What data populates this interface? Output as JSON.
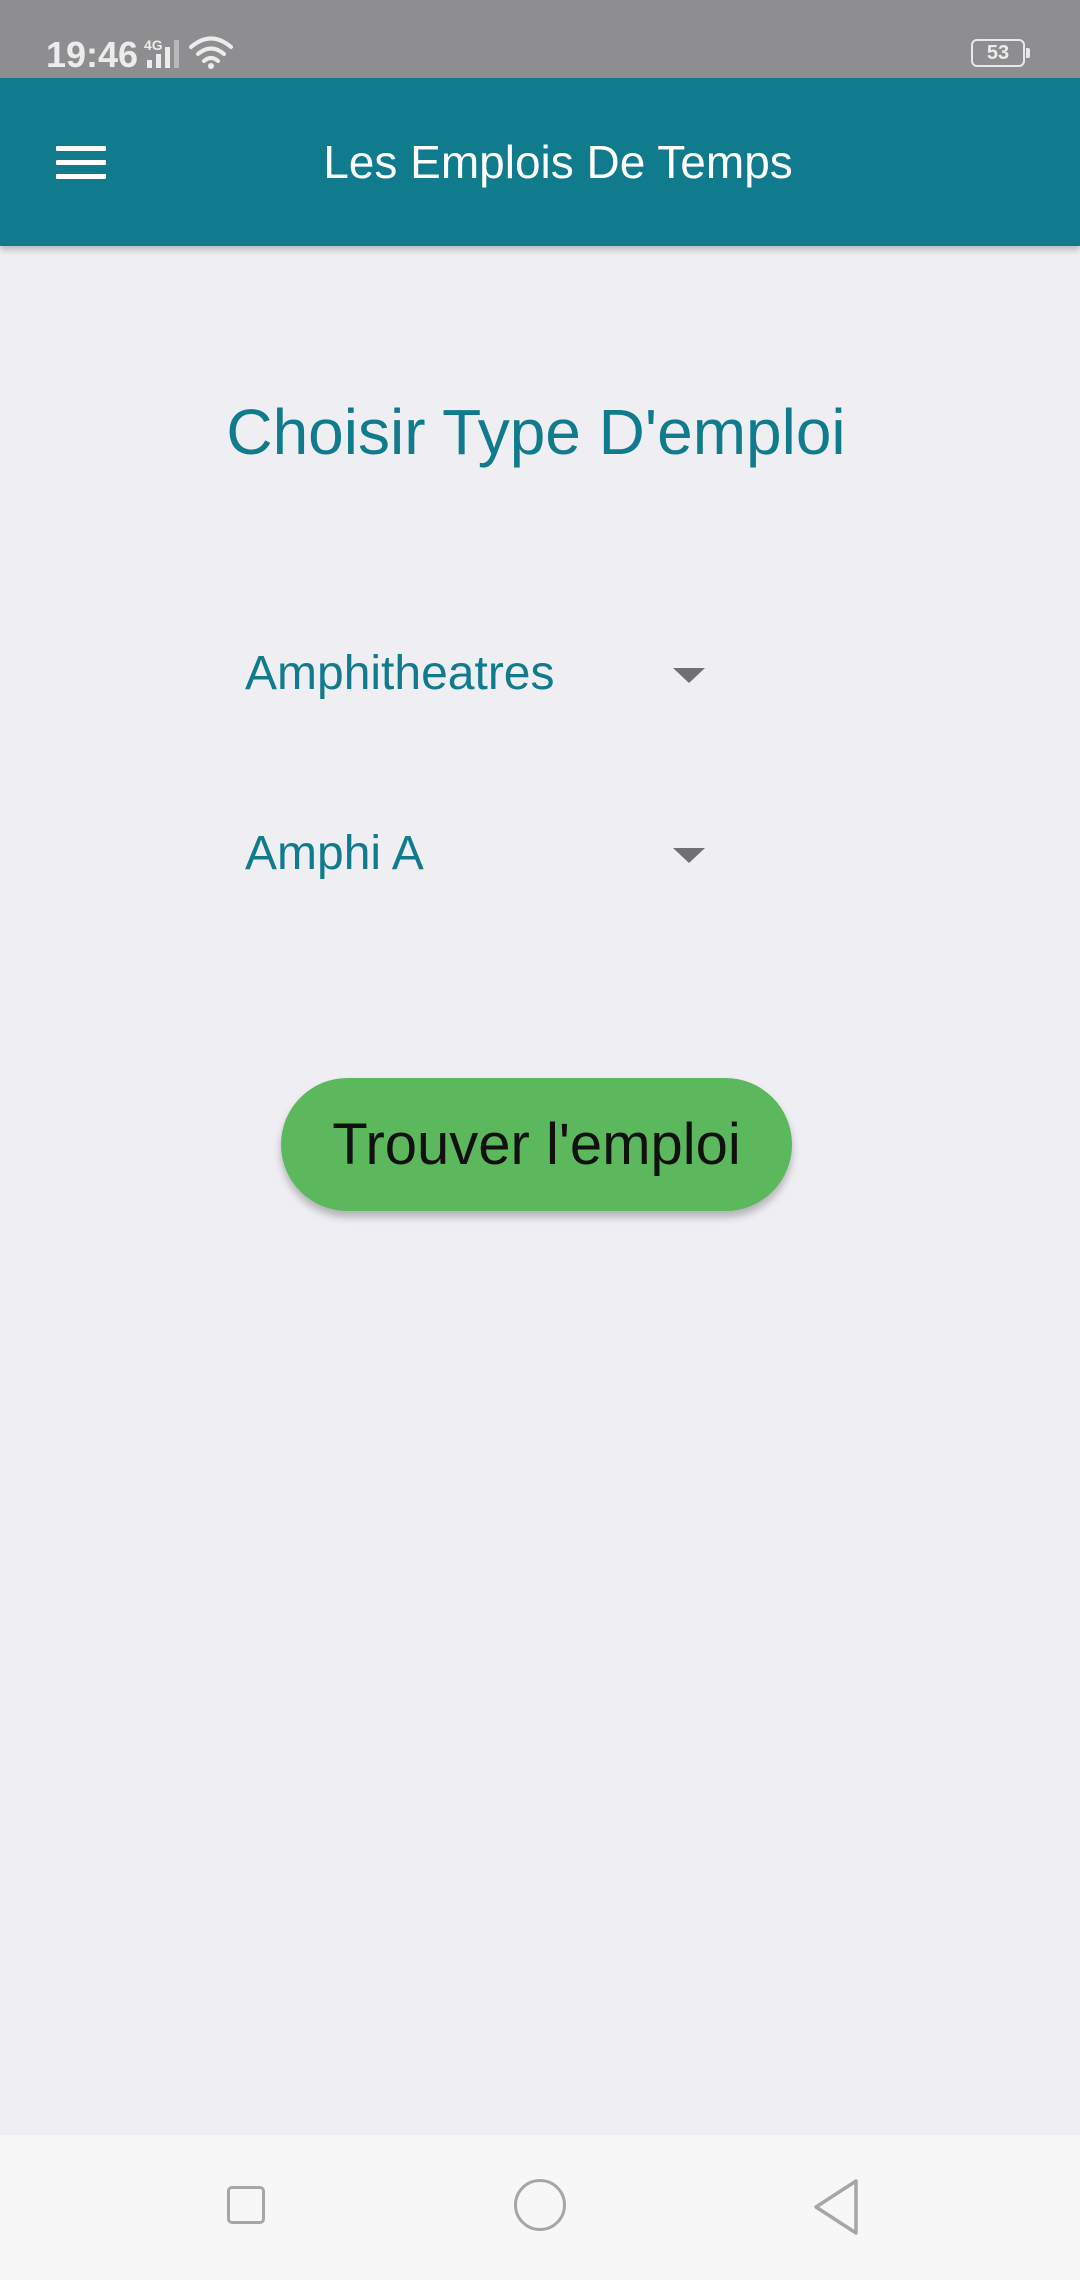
{
  "status_bar": {
    "time": "19:46",
    "network": "4G",
    "battery": "53",
    "icons": [
      "signal-icon",
      "wifi-icon",
      "battery-icon"
    ]
  },
  "app_bar": {
    "menu_icon": "hamburger-menu-icon",
    "title": "Les Emplois De Temps",
    "color": "#0f7b8c"
  },
  "main": {
    "heading": "Choisir Type D'emploi",
    "type_dropdown": {
      "selected": "Amphitheatres"
    },
    "room_dropdown": {
      "selected": "Amphi A"
    },
    "find_button": {
      "label": "Trouver l'emploi",
      "color": "#5cb85c"
    }
  },
  "nav_bar": {
    "icons": [
      "recent-apps-icon",
      "home-icon",
      "back-icon"
    ]
  }
}
